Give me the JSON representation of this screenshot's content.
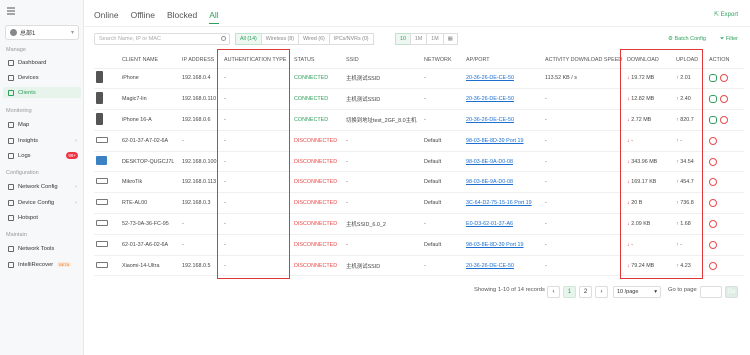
{
  "sidebar": {
    "site": "总部1",
    "sections": {
      "manage": "Manage",
      "monitoring": "Monitoring",
      "configuration": "Configuration",
      "maintain": "Maintain"
    },
    "items": [
      {
        "label": "Dashboard"
      },
      {
        "label": "Devices"
      },
      {
        "label": "Clients"
      },
      {
        "label": "Map"
      },
      {
        "label": "Insights"
      },
      {
        "label": "Logs",
        "badge": "99+"
      },
      {
        "label": "Network Config"
      },
      {
        "label": "Device Config"
      },
      {
        "label": "Hotspot"
      },
      {
        "label": "Network Tools"
      },
      {
        "label": "IntelliRecover",
        "tag": "BETA"
      }
    ]
  },
  "tabs": [
    "Online",
    "Offline",
    "Blocked",
    "All"
  ],
  "export": "Export",
  "search": {
    "placeholder": "Search Name, IP or MAC"
  },
  "filters": {
    "all": "All (14)",
    "wireless": "Wireless (8)",
    "wired": "Wired (6)",
    "ipsec": "IPCs/NVRs (0)",
    "r1": "10",
    "r2": "1M",
    "r3": "1M"
  },
  "batch": "Batch Config",
  "filter": "Filter",
  "columns": [
    "CLIENT NAME",
    "IP ADDRESS",
    "AUTHENTICATION TYPE",
    "STATUS",
    "SSID",
    "NETWORK",
    "AP/PORT",
    "ACTIVITY DOWNLOAD SPEED",
    "DOWNLOAD",
    "UPLOAD",
    "ACTION"
  ],
  "rows": [
    {
      "name": "iPhone",
      "ip": "192.168.0.4",
      "auth": "-",
      "status": "CONNECTED",
      "ssid": "主机测试SSID",
      "network": "-",
      "ap": "20-36-26-DE-CE-50",
      "speed": "113.52 KB / s",
      "down": "19.72 MB",
      "up": "2.01"
    },
    {
      "name": "Magic7-lin",
      "ip": "192.168.0.110",
      "auth": "-",
      "status": "CONNECTED",
      "ssid": "主机测试SSID",
      "network": "-",
      "ap": "20-36-26-DE-CE-50",
      "speed": "-",
      "down": "12.82 MB",
      "up": "2.40"
    },
    {
      "name": "iPhone 16-A",
      "ip": "192.168.0.6",
      "auth": "-",
      "status": "CONNECTED",
      "ssid": "切换到地址test_2GF_8.0主机",
      "network": "-",
      "ap": "20-36-26-DE-CE-50",
      "speed": "-",
      "down": "2.72 MB",
      "up": "820.7"
    },
    {
      "name": "62-01-37-A7-02-6A",
      "ip": "-",
      "auth": "-",
      "status": "DISCONNECTED",
      "ssid": "-",
      "network": "Default",
      "ap": "98-03-8E-8D-39 Port 19",
      "speed": "-",
      "down": "-",
      "up": "-"
    },
    {
      "name": "DESKTOP-QUGCJ7L",
      "ip": "192.168.0.100",
      "auth": "-",
      "status": "DISCONNECTED",
      "ssid": "-",
      "network": "Default",
      "ap": "98-03-8E-9A-D0-08",
      "speed": "-",
      "down": "343.96 MB",
      "up": "34.54"
    },
    {
      "name": "MikroTik",
      "ip": "192.168.0.113",
      "auth": "-",
      "status": "DISCONNECTED",
      "ssid": "-",
      "network": "Default",
      "ap": "98-03-8E-9A-D0-08",
      "speed": "-",
      "down": "169.17 KB",
      "up": "454.7"
    },
    {
      "name": "RTE-AL00",
      "ip": "192.168.0.3",
      "auth": "-",
      "status": "DISCONNECTED",
      "ssid": "-",
      "network": "Default",
      "ap": "3C-64-D2-75-15-16 Port 19",
      "speed": "-",
      "down": "20 B",
      "up": "736.8"
    },
    {
      "name": "52-73-0A-36-FC-95",
      "ip": "-",
      "auth": "-",
      "status": "DISCONNECTED",
      "ssid": "主机SSID_6.0_2",
      "network": "-",
      "ap": "E0-D3-62-01-37-A6",
      "speed": "-",
      "down": "2.09 KB",
      "up": "1.68"
    },
    {
      "name": "62-01-37-A6-02-6A",
      "ip": "-",
      "auth": "-",
      "status": "DISCONNECTED",
      "ssid": "-",
      "network": "Default",
      "ap": "98-03-8E-8D-39 Port 19",
      "speed": "-",
      "down": "-",
      "up": "-"
    },
    {
      "name": "Xiaomi-14-Ultra",
      "ip": "192.168.0.5",
      "auth": "-",
      "status": "DISCONNECTED",
      "ssid": "主机测试SSID",
      "network": "-",
      "ap": "20-36-26-DE-CE-50",
      "speed": "-",
      "down": "79.24 MB",
      "up": "4.23"
    }
  ],
  "pager": {
    "summary": "Showing 1-10 of 14 records",
    "p1": "1",
    "p2": "2",
    "per": "10 /page",
    "goto": "Go to page",
    "go": "Go"
  }
}
